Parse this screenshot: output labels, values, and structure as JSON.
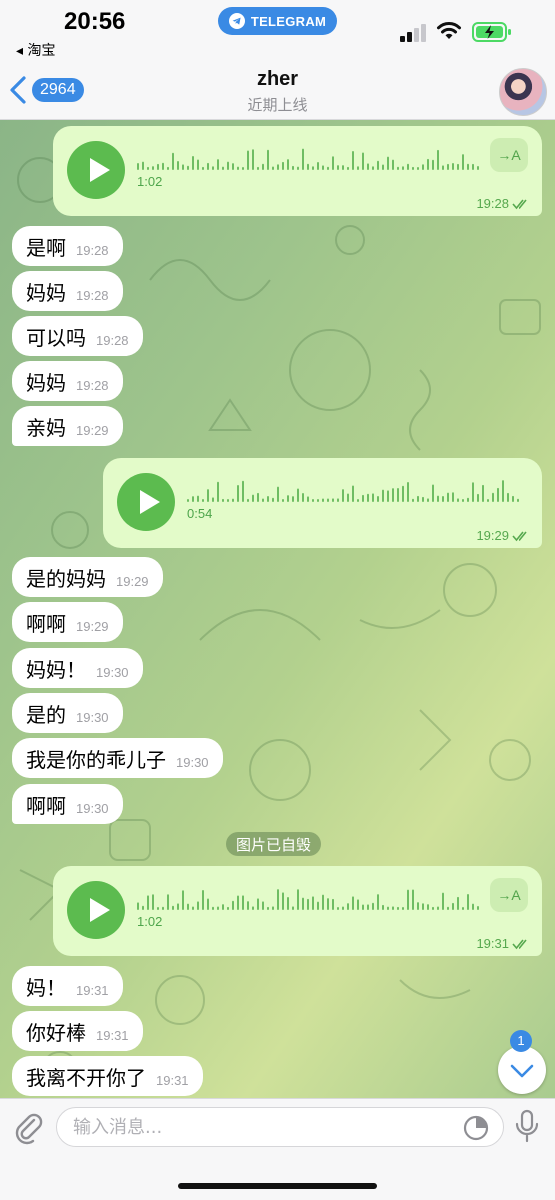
{
  "status_bar": {
    "time": "20:56",
    "back_app": "◂ 淘宝",
    "app_pill": "TELEGRAM",
    "colors": {
      "pill": "#3a8ae4",
      "battery_charge": "#4cd964"
    }
  },
  "nav": {
    "back_count": "2964",
    "title": "zher",
    "subtitle": "近期上线"
  },
  "messages": {
    "voice1": {
      "duration": "1:02",
      "time": "19:28",
      "transcribe_label": "→A"
    },
    "m1": {
      "text": "是啊",
      "time": "19:28"
    },
    "m2": {
      "text": "妈妈",
      "time": "19:28"
    },
    "m3": {
      "text": "可以吗",
      "time": "19:28"
    },
    "m4": {
      "text": "妈妈",
      "time": "19:28"
    },
    "m5": {
      "text": "亲妈",
      "time": "19:29"
    },
    "voice2": {
      "duration": "0:54",
      "time": "19:29"
    },
    "m6": {
      "text": "是的妈妈",
      "time": "19:29"
    },
    "m7": {
      "text": "啊啊",
      "time": "19:29"
    },
    "m8": {
      "text": "妈妈！",
      "time": "19:30"
    },
    "m9": {
      "text": "是的",
      "time": "19:30"
    },
    "m10": {
      "text": "我是你的乖儿子",
      "time": "19:30"
    },
    "m11": {
      "text": "啊啊",
      "time": "19:30"
    },
    "service": "图片已自毁",
    "voice3": {
      "duration": "1:02",
      "time": "19:31",
      "transcribe_label": "→A"
    },
    "m12": {
      "text": "妈！",
      "time": "19:31"
    },
    "m13": {
      "text": "你好棒",
      "time": "19:31"
    },
    "m14": {
      "text": "我离不开你了",
      "time": "19:31"
    }
  },
  "scroll": {
    "unread_count": "1"
  },
  "input": {
    "placeholder": "输入消息..."
  },
  "colors": {
    "bubble_out": "#e3fbc9",
    "bubble_in": "#ffffff",
    "play_button": "#5cbb4f",
    "accent": "#3a8ae4"
  },
  "icons": [
    "telegram-icon",
    "signal-icon",
    "wifi-icon",
    "battery-icon",
    "chevron-left-icon",
    "play-icon",
    "double-check-icon",
    "chevron-down-icon",
    "paperclip-icon",
    "sticker-icon",
    "microphone-icon"
  ]
}
